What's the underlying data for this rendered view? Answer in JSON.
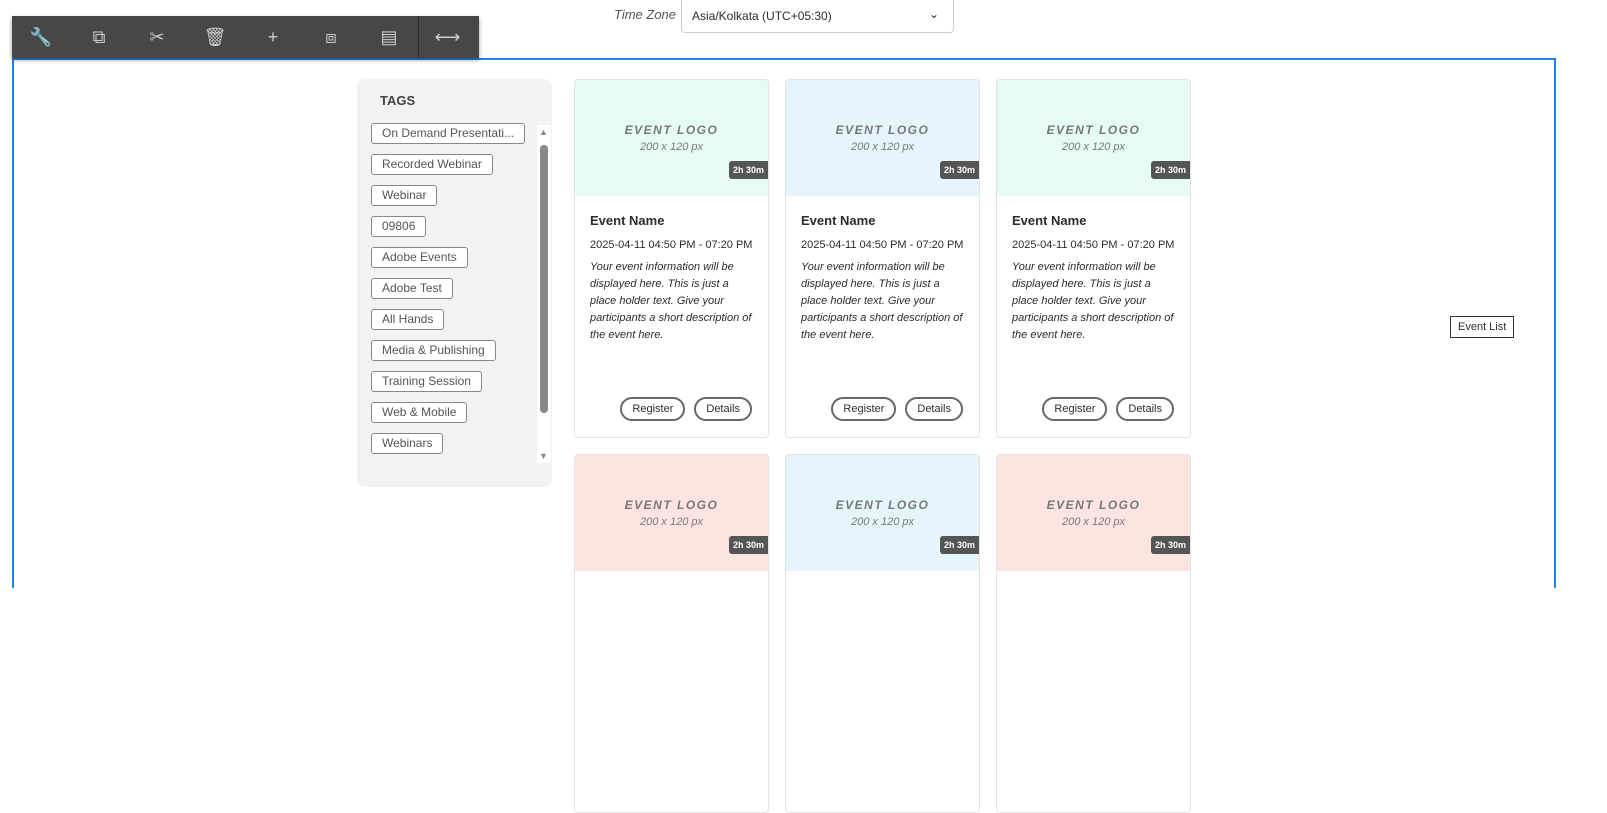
{
  "timezone": {
    "label": "Time Zone",
    "value": "Asia/Kolkata (UTC+05:30)"
  },
  "toolbar": [
    {
      "icon": "wrench-icon",
      "glyph": "🔧"
    },
    {
      "icon": "copy-icon",
      "glyph": "⧉"
    },
    {
      "icon": "scissors-icon",
      "glyph": "✂"
    },
    {
      "icon": "trash-icon",
      "glyph": "🗑"
    },
    {
      "icon": "plus-icon",
      "glyph": "+"
    },
    {
      "icon": "frame-icon",
      "glyph": "⧈"
    },
    {
      "icon": "table-icon",
      "glyph": "▤"
    },
    {
      "icon": "resize-horizontal-icon",
      "glyph": "⟷"
    }
  ],
  "tags": {
    "title": "TAGS",
    "items": [
      "On Demand Presentati...",
      "Recorded Webinar",
      "Webinar",
      "09806",
      "Adobe Events",
      "Adobe Test",
      "All Hands",
      "Media & Publishing",
      "Training Session",
      "Web & Mobile",
      "Webinars"
    ]
  },
  "cards": [
    {
      "logo": "EVENT LOGO",
      "size": "200 x 120 px",
      "duration": "2h 30m",
      "name": "Event Name",
      "date": "2025-04-11 04:50 PM - 07:20 PM",
      "desc": "Your event information will be displayed here. This is just a place holder text. Give your participants a short description of the event here.",
      "register": "Register",
      "details": "Details",
      "color": "#e6fbf5"
    },
    {
      "logo": "EVENT LOGO",
      "size": "200 x 120 px",
      "duration": "2h 30m",
      "name": "Event Name",
      "date": "2025-04-11 04:50 PM - 07:20 PM",
      "desc": "Your event information will be displayed here. This is just a place holder text. Give your participants a short description of the event here.",
      "register": "Register",
      "details": "Details",
      "color": "#e6f5fc"
    },
    {
      "logo": "EVENT LOGO",
      "size": "200 x 120 px",
      "duration": "2h 30m",
      "name": "Event Name",
      "date": "2025-04-11 04:50 PM - 07:20 PM",
      "desc": "Your event information will be displayed here. This is just a place holder text. Give your participants a short description of the event here.",
      "register": "Register",
      "details": "Details",
      "color": "#e6fbf5"
    },
    {
      "logo": "EVENT LOGO",
      "size": "200 x 120 px",
      "duration": "2h 30m",
      "color": "#fde4e1"
    },
    {
      "logo": "EVENT LOGO",
      "size": "200 x 120 px",
      "duration": "2h 30m",
      "color": "#e6f5fc"
    },
    {
      "logo": "EVENT LOGO",
      "size": "200 x 120 px",
      "duration": "2h 30m",
      "color": "#fde4e1"
    }
  ],
  "component_label": "Event List"
}
